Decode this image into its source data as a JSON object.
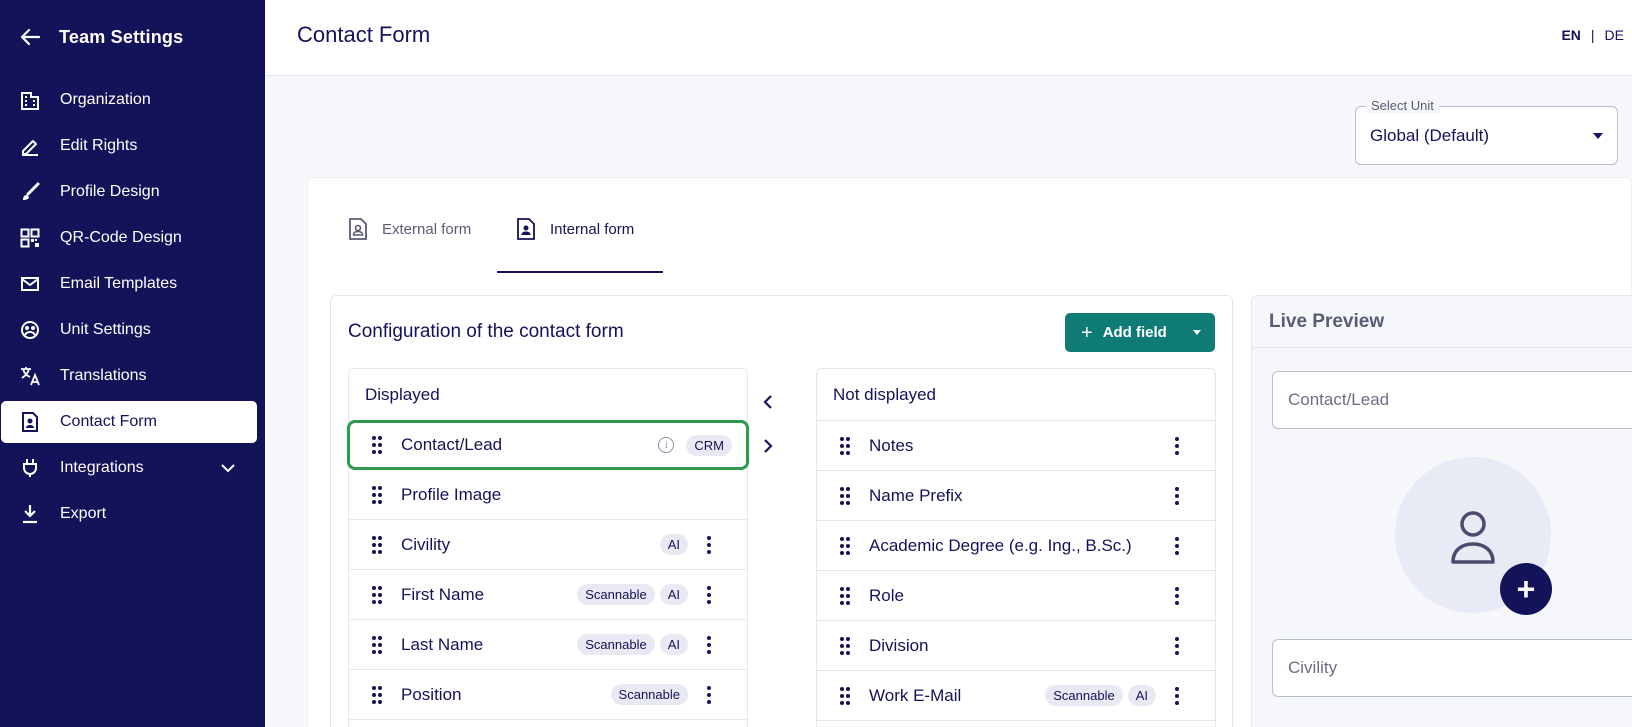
{
  "sidebar": {
    "title": "Team Settings",
    "items": [
      {
        "label": "Organization",
        "icon": "building-icon"
      },
      {
        "label": "Edit Rights",
        "icon": "edit-pen-icon"
      },
      {
        "label": "Profile Design",
        "icon": "brush-icon"
      },
      {
        "label": "QR-Code Design",
        "icon": "qr-code-icon"
      },
      {
        "label": "Email Templates",
        "icon": "email-icon"
      },
      {
        "label": "Unit Settings",
        "icon": "unit-settings-icon"
      },
      {
        "label": "Translations",
        "icon": "translate-icon"
      },
      {
        "label": "Contact Form",
        "icon": "contact-form-icon"
      },
      {
        "label": "Integrations",
        "icon": "plug-icon"
      },
      {
        "label": "Export",
        "icon": "download-icon"
      }
    ],
    "active_item": "Contact Form"
  },
  "header": {
    "title": "Contact Form",
    "lang_en": "EN",
    "lang_sep": "|",
    "lang_de": "DE"
  },
  "select_unit": {
    "label": "Select Unit",
    "value": "Global (Default)"
  },
  "tabs": [
    {
      "label": "External form"
    },
    {
      "label": "Internal form"
    }
  ],
  "active_tab": "Internal form",
  "config": {
    "title": "Configuration of the contact form",
    "add_field_label": "Add field",
    "displayed_title": "Displayed",
    "not_displayed_title": "Not displayed",
    "displayed": [
      {
        "label": "Contact/Lead",
        "badges": [
          "CRM"
        ],
        "info": "i",
        "selected": true
      },
      {
        "label": "Profile Image",
        "badges": []
      },
      {
        "label": "Civility",
        "badges": [
          "AI"
        ]
      },
      {
        "label": "First Name",
        "badges": [
          "Scannable",
          "AI"
        ]
      },
      {
        "label": "Last Name",
        "badges": [
          "Scannable",
          "AI"
        ]
      },
      {
        "label": "Position",
        "badges": [
          "Scannable"
        ]
      }
    ],
    "not_displayed": [
      {
        "label": "Notes",
        "badges": []
      },
      {
        "label": "Name Prefix",
        "badges": []
      },
      {
        "label": "Academic Degree (e.g. Ing., B.Sc.)",
        "badges": []
      },
      {
        "label": "Role",
        "badges": []
      },
      {
        "label": "Division",
        "badges": []
      },
      {
        "label": "Work E-Mail",
        "badges": [
          "Scannable",
          "AI"
        ]
      }
    ]
  },
  "preview": {
    "title": "Live Preview",
    "field1": "Contact/Lead",
    "field2": "Civility",
    "add_symbol": "+"
  },
  "colors": {
    "sidebar_bg": "#13135a",
    "accent": "#0e7c74",
    "selected_border": "#2e9a4e"
  }
}
